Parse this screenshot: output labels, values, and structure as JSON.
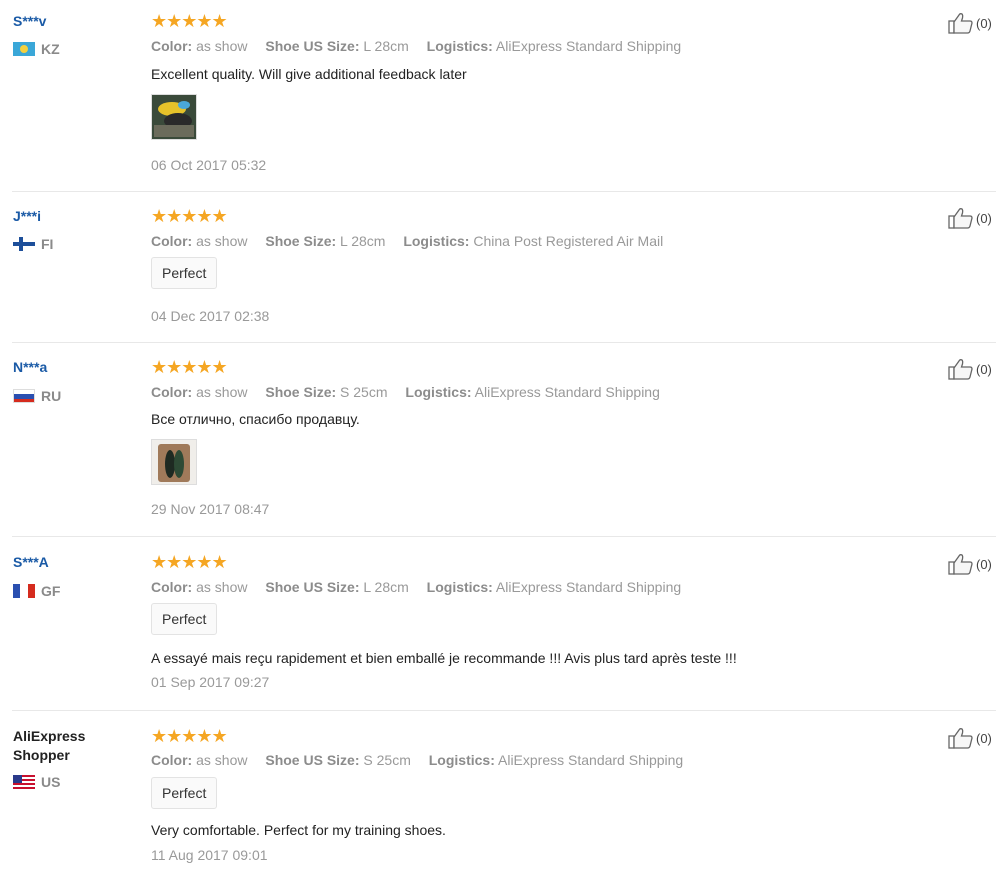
{
  "labels": {
    "color": "Color:",
    "shoe_us_size": "Shoe US Size:",
    "shoe_size": "Shoe Size:",
    "logistics": "Logistics:"
  },
  "colors": {
    "star": "#f5a623",
    "user_link": "#1a5aa6"
  },
  "reviews": [
    {
      "user": "S***v",
      "country": "KZ",
      "flag": "flag-kazakhstan-icon",
      "stars": "★★★★★",
      "rating": 5,
      "color": "as show",
      "size": "L 28cm",
      "logistics": "AliExpress Standard Shipping",
      "text": "Excellent quality. Will give additional feedback later",
      "date": "06 Oct 2017 05:32",
      "likes": "(0)"
    },
    {
      "user": "J***i",
      "country": "FI",
      "flag": "flag-finland-icon",
      "stars": "★★★★★",
      "rating": 5,
      "color": "as show",
      "size": "L 28cm",
      "logistics": "China Post Registered Air Mail",
      "tag": "Perfect",
      "date": "04 Dec 2017 02:38",
      "likes": "(0)"
    },
    {
      "user": "N***a",
      "country": "RU",
      "flag": "flag-russia-icon",
      "stars": "★★★★★",
      "rating": 5,
      "color": "as show",
      "size": "S 25cm",
      "logistics": "AliExpress Standard Shipping",
      "text": "Все отлично, спасибо продавцу.",
      "date": "29 Nov 2017 08:47",
      "likes": "(0)"
    },
    {
      "user": "S***A",
      "country": "GF",
      "flag": "flag-french-guiana-icon",
      "stars": "★★★★★",
      "rating": 5,
      "color": "as show",
      "size": "L 28cm",
      "logistics": "AliExpress Standard Shipping",
      "tag": "Perfect",
      "text": "A essayé mais reçu rapidement et bien emballé je recommande !!! Avis plus tard après teste !!!",
      "date": "01 Sep 2017 09:27",
      "likes": "(0)"
    },
    {
      "user": "AliExpress Shopper",
      "country": "US",
      "flag": "flag-usa-icon",
      "stars": "★★★★★",
      "rating": 5,
      "color": "as show",
      "size": "S 25cm",
      "logistics": "AliExpress Standard Shipping",
      "tag": "Perfect",
      "text": "Very comfortable. Perfect for my training shoes.",
      "date": "11 Aug 2017 09:01",
      "likes": "(0)"
    }
  ]
}
